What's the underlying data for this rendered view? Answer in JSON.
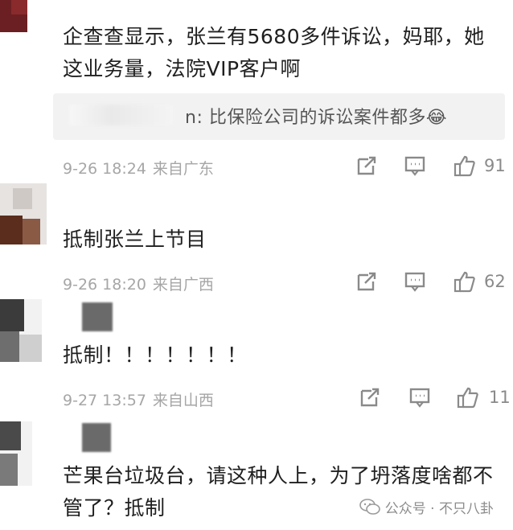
{
  "comments": [
    {
      "text": "企查查显示，张兰有5680多件诉讼，妈耶，她这业务量，法院VIP客户啊",
      "reply": {
        "text": "n: 比保险公司的诉讼案件都多😂"
      },
      "time": "9-26 18:24",
      "location": "来自广东",
      "likes": "91"
    },
    {
      "text": "抵制张兰上节目",
      "time": "9-26 18:20",
      "location": "来自广西",
      "likes": "62"
    },
    {
      "text": "抵制！！！！！！！",
      "time": "9-27 13:57",
      "location": "来自山西",
      "likes": "11"
    },
    {
      "text": "芒果台垃圾台，请这种人上，为了坍落度啥都不管了？抵制"
    }
  ],
  "icons": {
    "share": "share-icon",
    "comment": "comment-icon",
    "like": "thumbs-up-icon"
  },
  "watermark": {
    "text": "公众号 · 不只八卦"
  }
}
